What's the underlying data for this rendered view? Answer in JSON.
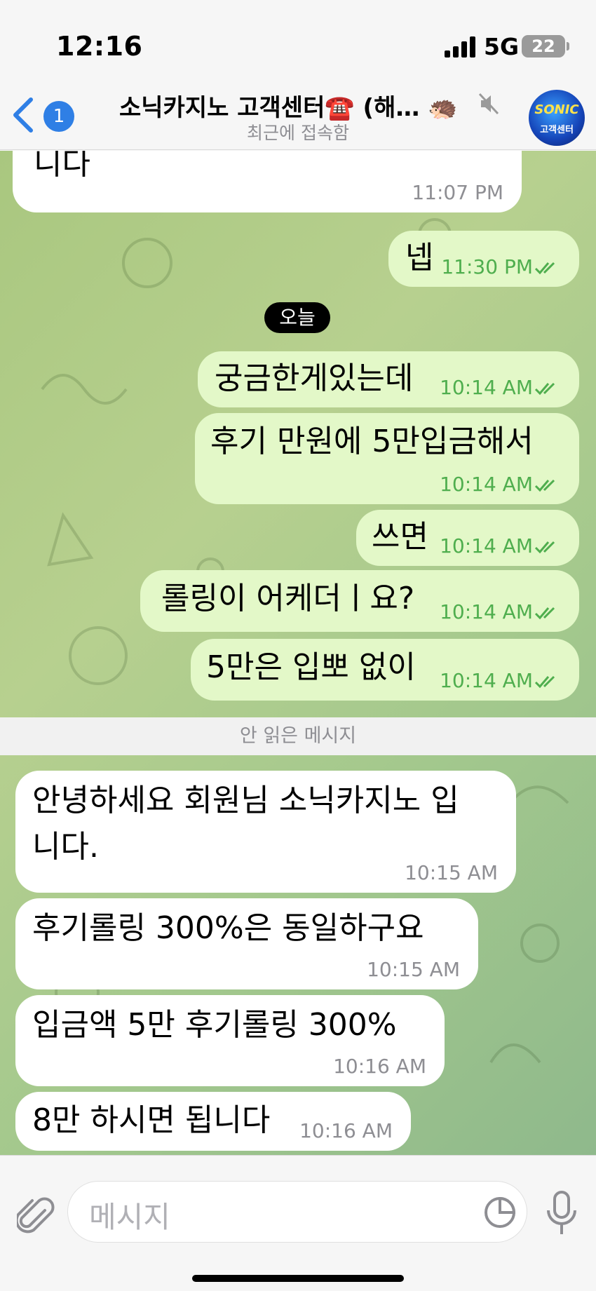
{
  "status_bar": {
    "time": "12:16",
    "network": "5G",
    "battery": "22"
  },
  "header": {
    "unread_count": "1",
    "title": "소닉카지노 고객센터☎️ (해… 🦔",
    "subtitle": "최근에 접속함",
    "avatar_text": "고객센터",
    "avatar_logo": "SONIC"
  },
  "messages_before": [
    {
      "direction": "in",
      "text_lines": [
        "니다"
      ],
      "time": "11:07 PM"
    },
    {
      "direction": "out",
      "text_lines": [
        "넵"
      ],
      "time": "11:30 PM"
    }
  ],
  "date_separator": "오늘",
  "messages_out_today": [
    {
      "text_lines": [
        "궁금한게있는데"
      ],
      "time": "10:14 AM"
    },
    {
      "text_lines": [
        "후기 만원에 5만입금해서"
      ],
      "time": "10:14 AM"
    },
    {
      "text_lines": [
        "쓰면"
      ],
      "time": "10:14 AM"
    },
    {
      "text_lines": [
        "롤링이 어케더ㅣ요?"
      ],
      "time": "10:14 AM"
    },
    {
      "text_lines": [
        "5만은 입뽀 없이"
      ],
      "time": "10:14 AM"
    }
  ],
  "unread_divider": "안 읽은 메시지",
  "messages_in_today": [
    {
      "text_lines": [
        "안녕하세요 회원님 소닉카지노 입",
        "니다."
      ],
      "time": "10:15 AM"
    },
    {
      "text_lines": [
        "후기롤링 300%은 동일하구요"
      ],
      "time": "10:15 AM"
    },
    {
      "text_lines": [
        "입금액 5만 후기롤링 300%"
      ],
      "time": "10:16 AM"
    },
    {
      "text_lines": [
        "8만 하시면 됩니다"
      ],
      "time": "10:16 AM"
    }
  ],
  "input": {
    "placeholder": "메시지"
  },
  "colors": {
    "accent": "#2f7fe5",
    "outgoing_bubble": "#e3f8c8",
    "outgoing_meta": "#4fae4e",
    "incoming_bubble": "#ffffff"
  }
}
